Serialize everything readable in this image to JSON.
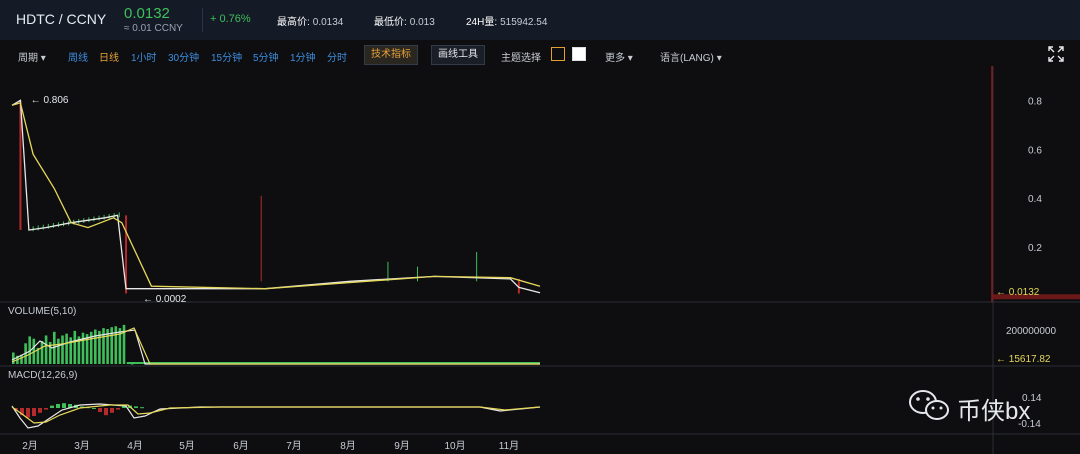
{
  "header": {
    "pair": "HDTC / CCNY",
    "price": "0.0132",
    "approx": "≈ 0.01 CCNY",
    "change": "+ 0.76%",
    "high_label": "最高价:",
    "high_value": "0.0134",
    "low_label": "最低价:",
    "low_value": "0.013",
    "vol_label": "24H量:",
    "vol_value": "515942.54"
  },
  "toolbar": {
    "period": "周期",
    "weekly": "周线",
    "daily": "日线",
    "h1": "1小时",
    "m30": "30分钟",
    "m15": "15分钟",
    "m5": "5分钟",
    "m1": "1分钟",
    "time": "分时",
    "indicators": "技术指标",
    "drawing": "画线工具",
    "theme": "主题选择",
    "more": "更多",
    "language": "语言(LANG)"
  },
  "colors": {
    "up": "#3fbf5a",
    "down": "#b52a2a",
    "ma_yellow": "#e6d85a",
    "ma_white": "#e8e8e8",
    "accent_blue": "#3d8ee0",
    "accent_orange": "#e6a23c"
  },
  "chart_data": [
    {
      "type": "line",
      "title": "",
      "x_ticks": [
        "2月",
        "3月",
        "4月",
        "5月",
        "6月",
        "7月",
        "8月",
        "9月",
        "10月",
        "11月"
      ],
      "y_ticks": [
        "0.8",
        "0.6",
        "0.4",
        "0.2"
      ],
      "ylim": [
        0,
        0.9
      ],
      "annotations": {
        "high": "← 0.806",
        "low": "← 0.0002",
        "last": "← 0.0132"
      },
      "series": [
        {
          "values": [
            [
              0,
              0.78
            ],
            [
              2,
              0.8
            ],
            [
              4,
              0.27
            ],
            [
              8,
              0.28
            ],
            [
              14,
              0.3
            ],
            [
              22,
              0.32
            ],
            [
              25,
              0.33
            ],
            [
              27,
              0.03
            ],
            [
              40,
              0.03
            ],
            [
              60,
              0.03
            ],
            [
              80,
              0.06
            ],
            [
              100,
              0.08
            ],
            [
              118,
              0.07
            ],
            [
              120,
              0.035
            ],
            [
              125,
              0.013
            ]
          ]
        },
        {
          "values": [
            [
              0,
              0.78
            ],
            [
              2,
              0.79
            ],
            [
              5,
              0.58
            ],
            [
              10,
              0.44
            ],
            [
              14,
              0.3
            ],
            [
              18,
              0.28
            ],
            [
              24,
              0.32
            ],
            [
              26,
              0.3
            ],
            [
              33,
              0.04
            ],
            [
              60,
              0.03
            ],
            [
              100,
              0.08
            ],
            [
              118,
              0.075
            ],
            [
              125,
              0.04
            ]
          ]
        }
      ],
      "spikes": [
        [
          59,
          0.41
        ],
        [
          89,
          0.14
        ],
        [
          96,
          0.12
        ],
        [
          110,
          0.18
        ]
      ]
    },
    {
      "type": "bar",
      "title": "VOLUME(5,10)",
      "y_ticks": [
        "200000000"
      ],
      "last_label": "← 15617.82",
      "values": [
        0.25,
        0.18,
        0.2,
        0.45,
        0.6,
        0.55,
        0.35,
        0.5,
        0.62,
        0.48,
        0.7,
        0.55,
        0.62,
        0.66,
        0.58,
        0.72,
        0.6,
        0.68,
        0.65,
        0.7,
        0.75,
        0.72,
        0.78,
        0.76,
        0.8,
        0.82,
        0.78,
        0.85,
        0.02,
        0.01
      ]
    },
    {
      "type": "bar",
      "title": "MACD(12,26,9)",
      "y_ticks": [
        "0.14",
        "-0.14"
      ],
      "values": [
        -0.02,
        -0.09,
        -0.12,
        -0.1,
        -0.06,
        -0.02,
        0.03,
        0.05,
        0.06,
        0.05,
        0.04,
        0.02,
        0.01,
        0,
        -0.05,
        -0.09,
        -0.06,
        -0.02,
        0.02,
        0.03,
        0.02,
        0.01
      ]
    }
  ],
  "watermark": {
    "text": "币侠bx"
  }
}
